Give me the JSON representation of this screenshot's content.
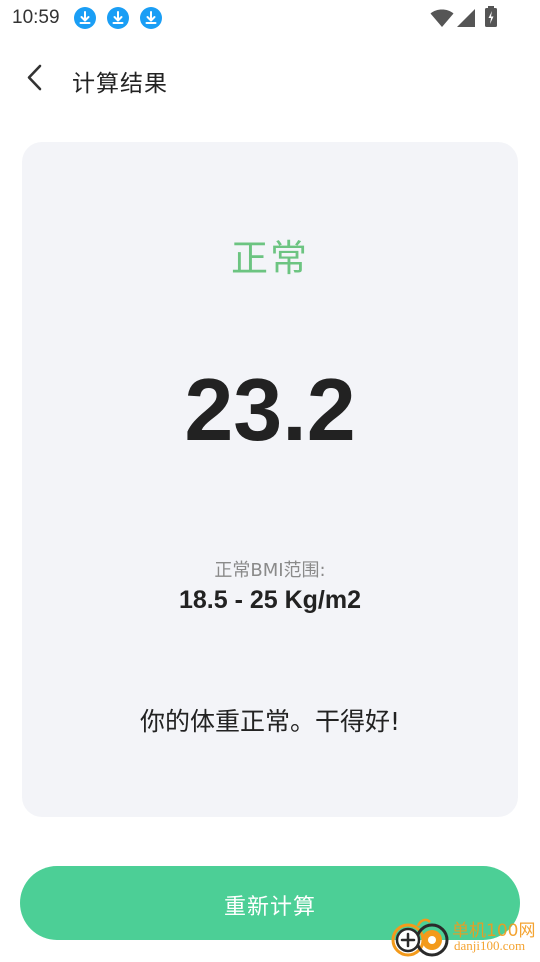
{
  "status_bar": {
    "time": "10:59",
    "notification_icons": [
      "download-icon",
      "download-icon",
      "download-icon"
    ],
    "right_icons": [
      "wifi-icon",
      "signal-icon",
      "battery-icon"
    ]
  },
  "header": {
    "back_icon": "chevron-left-icon",
    "title": "计算结果"
  },
  "result": {
    "status": "正常",
    "bmi": "23.2",
    "range_caption": "正常BMI范围:",
    "range_value": "18.5 - 25 Kg/m2",
    "message": "你的体重正常。干得好!"
  },
  "actions": {
    "recalculate_label": "重新计算"
  },
  "watermark": {
    "name": "单机100网",
    "url": "danji100.com"
  },
  "colors": {
    "status_green": "#6cc481",
    "button_green": "#4ccf96",
    "card_background": "#f3f4f8",
    "download_blue": "#1a9ef5"
  }
}
